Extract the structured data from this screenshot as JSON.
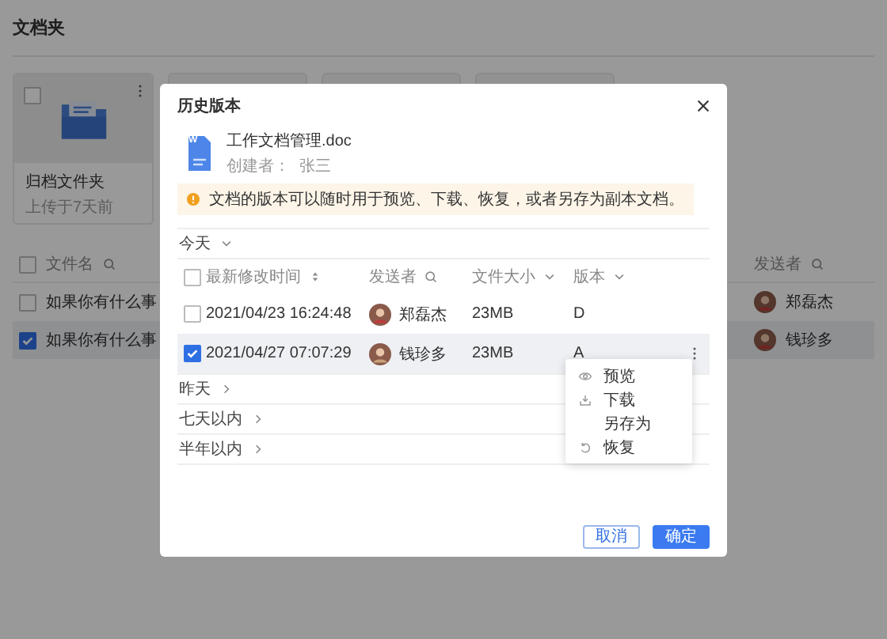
{
  "page": {
    "title": "文档夹"
  },
  "folder_cards": [
    {
      "kind": "folder",
      "name": "归档文件夹",
      "meta": "上传于7天前",
      "checked": false
    },
    {
      "kind": "blank"
    },
    {
      "kind": "blank"
    },
    {
      "kind": "blank"
    }
  ],
  "file_table": {
    "all_checked": false,
    "columns": [
      {
        "label": "文件名",
        "kind": "search"
      },
      {
        "label": "发送者",
        "kind": "search"
      }
    ],
    "rows": [
      {
        "name": "如果你有什么事",
        "sender": "郑磊杰",
        "checked": false,
        "selected": false
      },
      {
        "name": "如果你有什么事",
        "sender": "钱珍多",
        "checked": true,
        "selected": true
      }
    ]
  },
  "dialog": {
    "title": "历史版本",
    "file": {
      "badge": "W",
      "name": "工作文档管理.doc",
      "creator_label": "创建者：",
      "creator": "张三"
    },
    "notice": "文档的版本可以随时用于预览、下载、恢复，或者另存为副本文档。",
    "groups": [
      {
        "label": "今天",
        "expanded": true,
        "all_checked": false,
        "columns": [
          {
            "label": "最新修改时间",
            "kind": "sort"
          },
          {
            "label": "发送者",
            "kind": "search"
          },
          {
            "label": "文件大小",
            "kind": "filter"
          },
          {
            "label": "版本",
            "kind": "filter"
          }
        ],
        "rows": [
          {
            "time": "2021/04/23 16:24:48",
            "sender": "郑磊杰",
            "size": "23MB",
            "version": "D",
            "checked": false,
            "selected": false
          },
          {
            "time": "2021/04/27 07:07:29",
            "sender": "钱珍多",
            "size": "23MB",
            "version": "A",
            "checked": true,
            "selected": true
          }
        ]
      },
      {
        "label": "昨天",
        "expanded": false
      },
      {
        "label": "七天以内",
        "expanded": false
      },
      {
        "label": "半年以内",
        "expanded": false
      }
    ],
    "menu": [
      {
        "label": "预览",
        "kind": "preview"
      },
      {
        "label": "下载",
        "kind": "download"
      },
      {
        "label": "另存为",
        "kind": "save_as"
      },
      {
        "label": "恢复",
        "kind": "restore"
      }
    ],
    "buttons": [
      {
        "label": "取消",
        "kind": "secondary"
      },
      {
        "label": "确定",
        "kind": "primary"
      }
    ]
  }
}
